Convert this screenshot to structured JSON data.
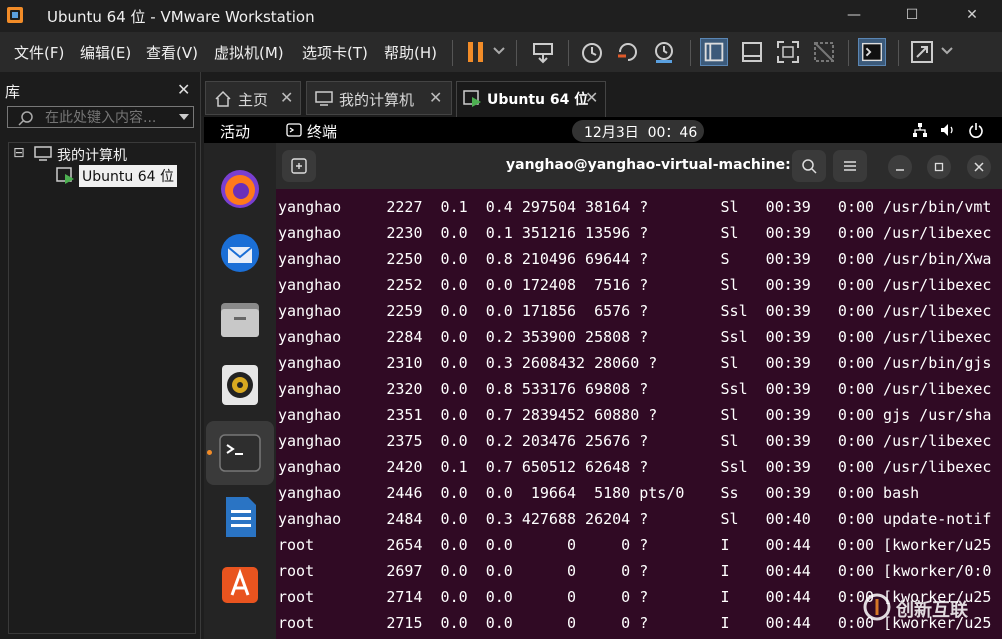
{
  "window": {
    "title": "Ubuntu 64 位 - VMware Workstation",
    "min_glyph": "—",
    "max_glyph": "☐",
    "close_glyph": "✕"
  },
  "menu": [
    "文件(F)",
    "编辑(E)",
    "查看(V)",
    "虚拟机(M)",
    "选项卡(T)",
    "帮助(H)"
  ],
  "colors": {
    "accent_orange": "#f28c28",
    "terminal_bg": "#300a24",
    "accent_blue": "#2a74c4"
  },
  "library": {
    "title": "库",
    "close": "✕",
    "search_placeholder": "在此处键入内容...",
    "tree": {
      "expander": "⊟",
      "root_label": "我的计算机",
      "child_label": "Ubuntu 64 位"
    }
  },
  "tabs": [
    {
      "label": "主页",
      "icon": "home-icon",
      "close": "✕"
    },
    {
      "label": "我的计算机",
      "icon": "monitor-icon",
      "close": "✕"
    },
    {
      "label": "Ubuntu 64 位",
      "icon": "vm-running-icon",
      "close": "✕"
    }
  ],
  "ubuntu": {
    "activities": "活动",
    "app_name": "终端",
    "clock": "12月3日  00：46"
  },
  "terminal": {
    "title": "yanghao@yanghao-virtual-machine: ~",
    "rows": [
      "yanghao     2227  0.1  0.4 297504 38164 ?        Sl   00:39   0:00 /usr/bin/vmt",
      "yanghao     2230  0.0  0.1 351216 13596 ?        Sl   00:39   0:00 /usr/libexec",
      "yanghao     2250  0.0  0.8 210496 69644 ?        S    00:39   0:00 /usr/bin/Xwa",
      "yanghao     2252  0.0  0.0 172408  7516 ?        Sl   00:39   0:00 /usr/libexec",
      "yanghao     2259  0.0  0.0 171856  6576 ?        Ssl  00:39   0:00 /usr/libexec",
      "yanghao     2284  0.0  0.2 353900 25808 ?        Ssl  00:39   0:00 /usr/libexec",
      "yanghao     2310  0.0  0.3 2608432 28060 ?       Sl   00:39   0:00 /usr/bin/gjs",
      "yanghao     2320  0.0  0.8 533176 69808 ?        Ssl  00:39   0:00 /usr/libexec",
      "yanghao     2351  0.0  0.7 2839452 60880 ?       Sl   00:39   0:00 gjs /usr/sha",
      "yanghao     2375  0.0  0.2 203476 25676 ?        Sl   00:39   0:00 /usr/libexec",
      "yanghao     2420  0.1  0.7 650512 62648 ?        Ssl  00:39   0:00 /usr/libexec",
      "yanghao     2446  0.0  0.0  19664  5180 pts/0    Ss   00:39   0:00 bash",
      "yanghao     2484  0.0  0.3 427688 26204 ?        Sl   00:40   0:00 update-notif",
      "root        2654  0.0  0.0      0     0 ?        I    00:44   0:00 [kworker/u25",
      "root        2697  0.0  0.0      0     0 ?        I    00:44   0:00 [kworker/0:0",
      "root        2714  0.0  0.0      0     0 ?        I    00:44   0:00 [kworker/u25",
      "root        2715  0.0  0.0      0     0 ?        I    00:44   0:00 [kworker/u25"
    ]
  },
  "watermark": "创新互联"
}
